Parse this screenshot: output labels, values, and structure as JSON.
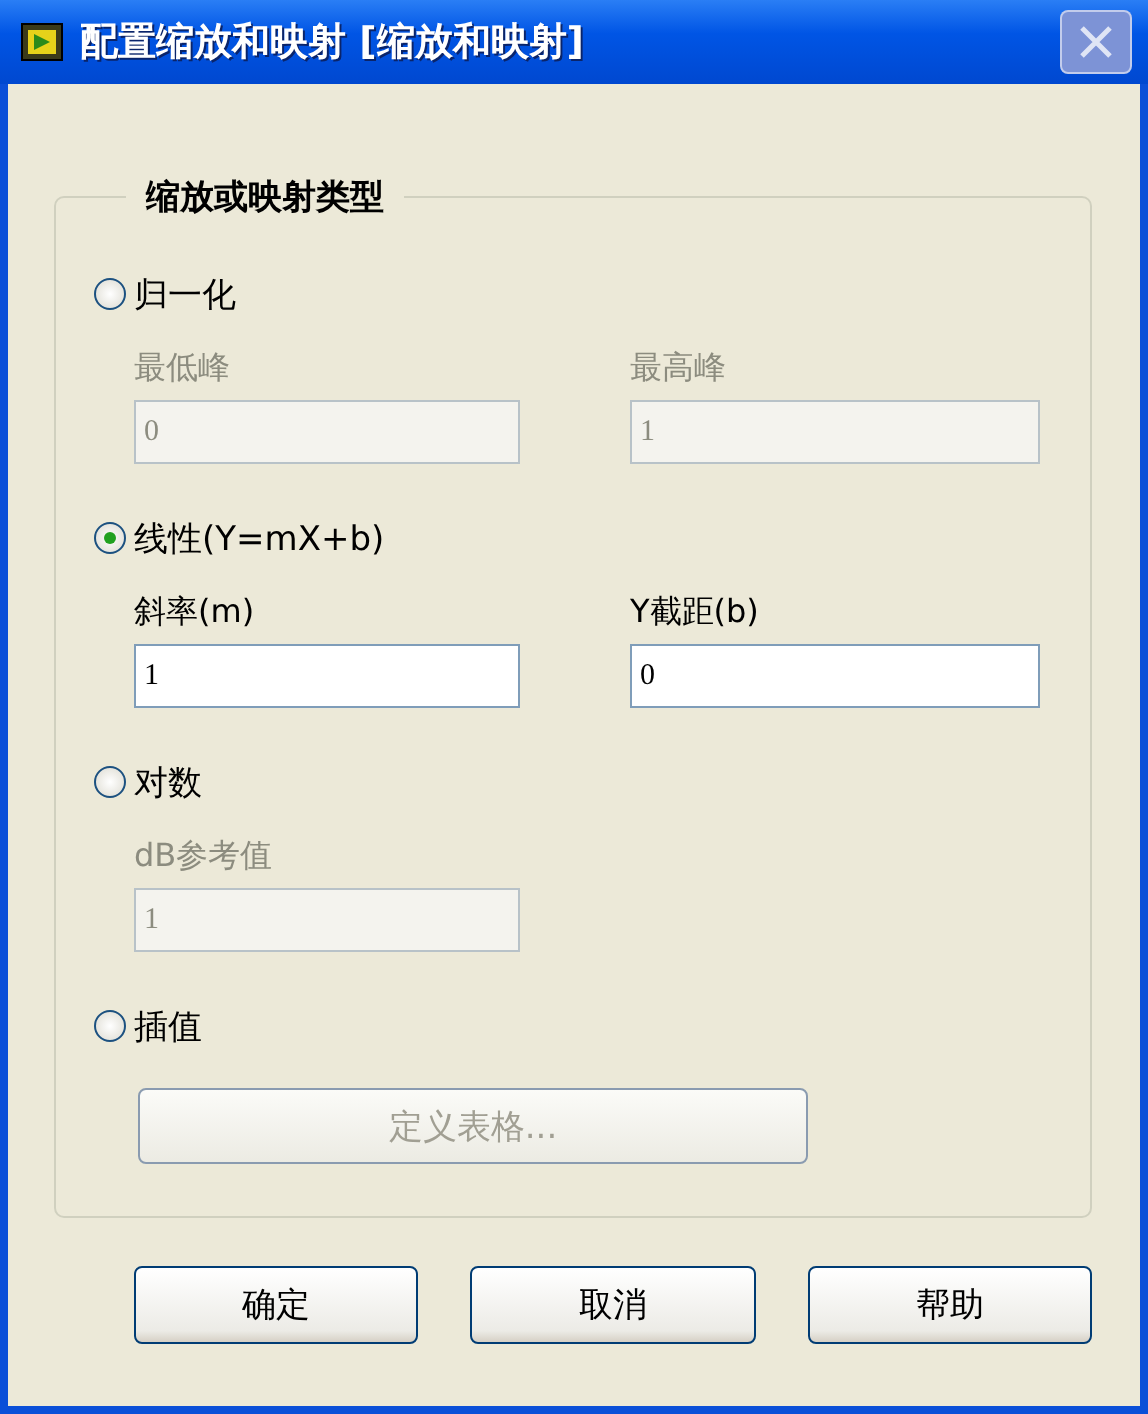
{
  "window": {
    "title": "配置缩放和映射 [缩放和映射]",
    "close_disabled": true
  },
  "group": {
    "legend": "缩放或映射类型",
    "options": [
      {
        "kind": "fields",
        "label": "归一化",
        "selected": false,
        "fields": [
          {
            "label": "最低峰",
            "value": "0",
            "disabled": true
          },
          {
            "label": "最高峰",
            "value": "1",
            "disabled": true
          }
        ]
      },
      {
        "kind": "fields",
        "label": "线性(Y=mX+b)",
        "selected": true,
        "fields": [
          {
            "label": "斜率(m)",
            "value": "1",
            "disabled": false
          },
          {
            "label": "Y截距(b)",
            "value": "0",
            "disabled": false
          }
        ]
      },
      {
        "kind": "fields",
        "label": "对数",
        "selected": false,
        "fields": [
          {
            "label": "dB参考值",
            "value": "1",
            "disabled": true
          }
        ]
      },
      {
        "kind": "button",
        "label": "插值",
        "selected": false,
        "button": {
          "label": "定义表格...",
          "disabled": true
        }
      }
    ]
  },
  "buttons": [
    "确定",
    "取消",
    "帮助"
  ]
}
